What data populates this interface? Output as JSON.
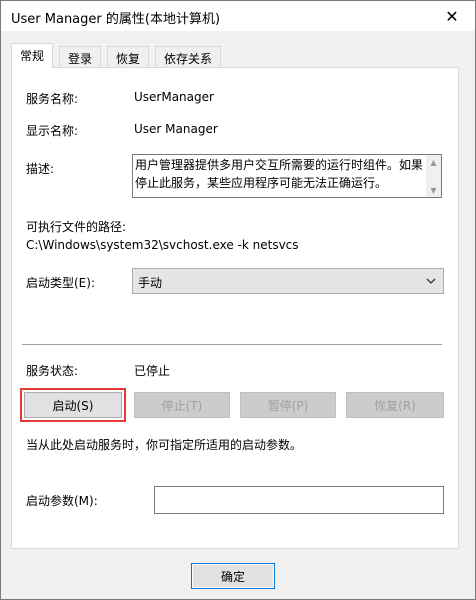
{
  "window": {
    "title": "User Manager 的属性(本地计算机)",
    "close_symbol": "✕"
  },
  "tabs": [
    {
      "label": "常规"
    },
    {
      "label": "登录"
    },
    {
      "label": "恢复"
    },
    {
      "label": "依存关系"
    }
  ],
  "general": {
    "service_name_label": "服务名称:",
    "service_name_value": "UserManager",
    "display_name_label": "显示名称:",
    "display_name_value": "User Manager",
    "description_label": "描述:",
    "description_value": "用户管理器提供多用户交互所需要的运行时组件。如果停止此服务，某些应用程序可能无法正确运行。",
    "exe_path_label": "可执行文件的路径:",
    "exe_path_value": "C:\\Windows\\system32\\svchost.exe -k netsvcs",
    "startup_type_label": "启动类型(E):",
    "startup_type_value": "手动",
    "service_status_label": "服务状态:",
    "service_status_value": "已停止",
    "hint_text": "当从此处启动服务时，你可指定所适用的启动参数。",
    "start_params_label": "启动参数(M):",
    "start_params_value": ""
  },
  "buttons": {
    "start": "启动(S)",
    "stop": "停止(T)",
    "pause": "暂停(P)",
    "resume": "恢复(R)",
    "ok": "确定"
  },
  "colors": {
    "highlight": "#e53935",
    "focus_border": "#0078d7"
  },
  "icons": {
    "close": "close-icon",
    "dropdown": "chevron-down-icon",
    "scroll_up": "scroll-up-icon",
    "scroll_down": "scroll-down-icon"
  }
}
